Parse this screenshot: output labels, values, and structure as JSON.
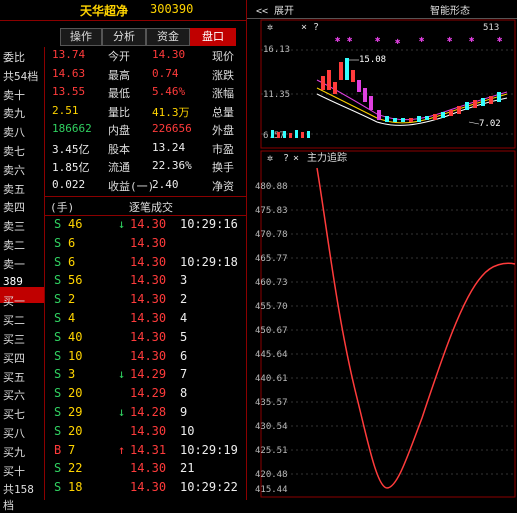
{
  "stock": {
    "code": "300390",
    "name": "天华超净"
  },
  "tabs": [
    {
      "label": "盘口",
      "active": true
    },
    {
      "label": "资金",
      "active": false
    },
    {
      "label": "分析",
      "active": false
    },
    {
      "label": "操作",
      "active": false
    }
  ],
  "depth_col": {
    "labels": [
      "委比",
      "共54档",
      "卖十",
      "卖九",
      "卖八",
      "卖七",
      "卖六",
      "卖五",
      "卖四",
      "卖三",
      "卖二",
      "卖一",
      "389",
      "买一",
      "买二",
      "买三",
      "买四",
      "买五",
      "买六",
      "买七",
      "买八",
      "买九",
      "买十",
      "共158档"
    ],
    "highlight_label": "389"
  },
  "quote": {
    "left": [
      {
        "label": "现价",
        "value": "14.30",
        "color": "red"
      },
      {
        "label": "涨跌",
        "value": "0.74",
        "color": "red"
      },
      {
        "label": "涨幅",
        "value": "5.46%",
        "color": "red"
      },
      {
        "label": "总量",
        "value": "41.3万",
        "color": "yellow"
      },
      {
        "label": "外盘",
        "value": "226656",
        "color": "red"
      },
      {
        "label": "市盈",
        "value": "13.24",
        "color": "white"
      },
      {
        "label": "换手",
        "value": "22.36%",
        "color": "white"
      },
      {
        "label": "净资",
        "value": "2.40",
        "color": "white"
      }
    ],
    "right": [
      {
        "label": "今开",
        "value": "13.74",
        "color": "red"
      },
      {
        "label": "最高",
        "value": "14.63",
        "color": "red"
      },
      {
        "label": "最低",
        "value": "13.55",
        "color": "red"
      },
      {
        "label": "量比",
        "value": "2.51",
        "color": "yellow"
      },
      {
        "label": "内盘",
        "value": "186662",
        "color": "green"
      },
      {
        "label": "股本",
        "value": "3.45亿",
        "color": "white"
      },
      {
        "label": "流通",
        "value": "1.85亿",
        "color": "white"
      },
      {
        "label": "收益(一)",
        "value": "0.022",
        "color": "white"
      }
    ]
  },
  "deals": {
    "title": "逐笔成交",
    "unit": "(手)",
    "rows": [
      {
        "time": "10:29:16",
        "price": "14.30",
        "arrow": "↓",
        "vol": "46",
        "flag": "S",
        "pc": "red",
        "fc": "green"
      },
      {
        "time": "",
        "price": "14.30",
        "arrow": "",
        "vol": "6",
        "flag": "S",
        "pc": "red",
        "fc": "green"
      },
      {
        "time": "10:29:18",
        "price": "14.30",
        "arrow": "",
        "vol": "6",
        "flag": "S",
        "pc": "red",
        "fc": "green"
      },
      {
        "time": "3",
        "price": "14.30",
        "arrow": "",
        "vol": "56",
        "flag": "S",
        "pc": "red",
        "fc": "green"
      },
      {
        "time": "2",
        "price": "14.30",
        "arrow": "",
        "vol": "2",
        "flag": "S",
        "pc": "red",
        "fc": "green"
      },
      {
        "time": "4",
        "price": "14.30",
        "arrow": "",
        "vol": "4",
        "flag": "S",
        "pc": "red",
        "fc": "green"
      },
      {
        "time": "5",
        "price": "14.30",
        "arrow": "",
        "vol": "40",
        "flag": "S",
        "pc": "red",
        "fc": "green"
      },
      {
        "time": "6",
        "price": "14.30",
        "arrow": "",
        "vol": "10",
        "flag": "S",
        "pc": "red",
        "fc": "green"
      },
      {
        "time": "7",
        "price": "14.29",
        "arrow": "↓",
        "vol": "3",
        "flag": "S",
        "pc": "red",
        "fc": "green"
      },
      {
        "time": "8",
        "price": "14.29",
        "arrow": "",
        "vol": "20",
        "flag": "S",
        "pc": "red",
        "fc": "green"
      },
      {
        "time": "9",
        "price": "14.28",
        "arrow": "↓",
        "vol": "29",
        "flag": "S",
        "pc": "red",
        "fc": "green"
      },
      {
        "time": "10",
        "price": "14.30",
        "arrow": "",
        "vol": "20",
        "flag": "S",
        "pc": "red",
        "fc": "green"
      },
      {
        "time": "10:29:19",
        "price": "14.31",
        "arrow": "↑",
        "vol": "7",
        "flag": "B",
        "pc": "red",
        "fc": "red"
      },
      {
        "time": "21",
        "price": "14.30",
        "arrow": "",
        "vol": "22",
        "flag": "S",
        "pc": "red",
        "fc": "green"
      },
      {
        "time": "10:29:22",
        "price": "14.30",
        "arrow": "",
        "vol": "18",
        "flag": "S",
        "pc": "red",
        "fc": "green"
      }
    ]
  },
  "right_panel": {
    "expand_label": "<< 展开",
    "indicator_title": "智能形态",
    "top_chart": {
      "price_labels": [
        "16.13",
        "11.35",
        "6.57"
      ],
      "high_label": "15.08",
      "low_label": "7.02",
      "header_label": "513"
    },
    "bottom_chart": {
      "title": "主力追踪",
      "axis_labels": [
        "480.88",
        "475.83",
        "470.78",
        "465.77",
        "460.73",
        "455.70",
        "450.67",
        "445.64",
        "440.61",
        "435.57",
        "430.54",
        "425.51",
        "420.48",
        "415.44"
      ]
    }
  },
  "colors": {
    "red": "#ff3b3b",
    "green": "#30d060",
    "yellow": "#ffd400",
    "border": "#8b0000"
  }
}
